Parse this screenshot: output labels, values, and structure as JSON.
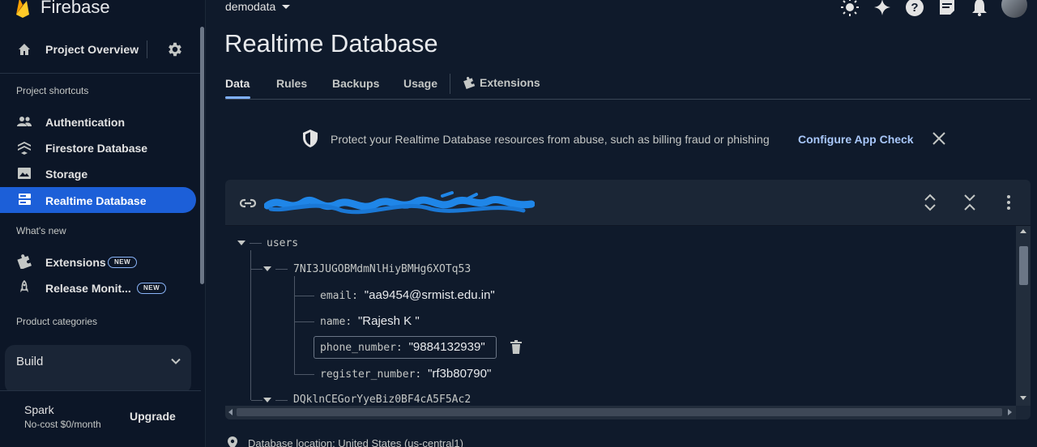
{
  "brand": {
    "name": "Firebase",
    "icon": "firebase-logo"
  },
  "sidebar": {
    "project_overview": "Project Overview",
    "sections": {
      "shortcuts": "Project shortcuts",
      "whats_new": "What's new",
      "categories": "Product categories"
    },
    "shortcuts": [
      {
        "label": "Authentication",
        "icon": "people-icon"
      },
      {
        "label": "Firestore Database",
        "icon": "firestore-icon"
      },
      {
        "label": "Storage",
        "icon": "storage-icon"
      },
      {
        "label": "Realtime Database",
        "icon": "realtime-database-icon",
        "active": true
      }
    ],
    "whats_new": [
      {
        "label": "Extensions",
        "badge": "NEW",
        "icon": "extensions-icon"
      },
      {
        "label": "Release Monit...",
        "badge": "NEW",
        "icon": "rocket-icon"
      }
    ],
    "build_label": "Build",
    "plan": {
      "name": "Spark",
      "price": "No-cost $0/month",
      "upgrade": "Upgrade"
    }
  },
  "topbar": {
    "project": "demodata"
  },
  "page": {
    "title": "Realtime Database",
    "tabs": [
      "Data",
      "Rules",
      "Backups",
      "Usage",
      "Extensions"
    ],
    "active_tab": "Data"
  },
  "banner": {
    "message": "Protect your Realtime Database resources from abuse, such as billing fraud or phishing",
    "action": "Configure App Check"
  },
  "tree": {
    "root": "users",
    "user1": {
      "id": "7NI3JUGOBMdmNlHiyBMHg6XOTq53",
      "fields": [
        {
          "key": "email",
          "value": "\"aa9454@srmist.edu.in\""
        },
        {
          "key": "name",
          "value": "\"Rajesh K \""
        },
        {
          "key": "phone_number",
          "value": "\"9884132939\""
        },
        {
          "key": "register_number",
          "value": "\"rf3b80790\""
        }
      ]
    },
    "user2": {
      "id": "DQklnCEGorYyeBiz0BF4cA5F5Ac2"
    }
  },
  "footer": {
    "location": "Database location: United States (us-central1)"
  },
  "colors": {
    "accent": "#1c5fd8",
    "link": "#a8c7fa",
    "background": "#0f1a2b"
  }
}
